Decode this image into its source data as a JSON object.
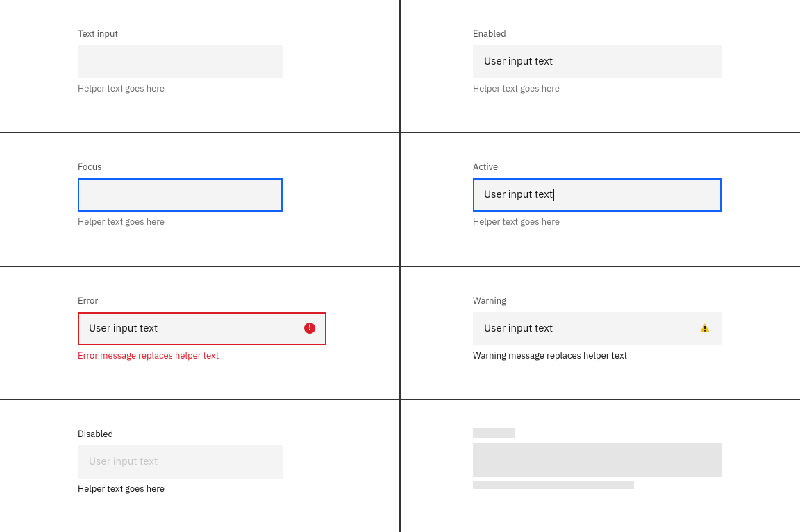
{
  "states": {
    "default": {
      "label": "Text input",
      "value": "",
      "helper": "Helper text goes here"
    },
    "enabled": {
      "label": "Enabled",
      "value": "User input text",
      "helper": "Helper text goes here"
    },
    "focus": {
      "label": "Focus",
      "value": "",
      "helper": "Helper text goes here"
    },
    "active": {
      "label": "Active",
      "value": "User input text",
      "helper": "Helper text goes here"
    },
    "error": {
      "label": "Error",
      "value": "User input text",
      "message": "Error message replaces helper text",
      "icon": "error-filled-icon"
    },
    "warning": {
      "label": "Warning",
      "value": "User input text",
      "message": "Warning message replaces helper text",
      "icon": "warning-filled-icon"
    },
    "disabled": {
      "label": "Disabled",
      "value": "User input text",
      "helper": "Helper text goes here"
    },
    "skeleton": {
      "label": "",
      "value": "",
      "helper": ""
    }
  },
  "colors": {
    "focus_outline": "#0f62fe",
    "error": "#da1e28",
    "field_bg": "#f4f4f4",
    "text_primary": "#161616",
    "text_secondary": "#525252",
    "text_helper": "#6f6f6f",
    "disabled_text": "#c6c6c6",
    "skeleton": "#e5e5e5"
  }
}
